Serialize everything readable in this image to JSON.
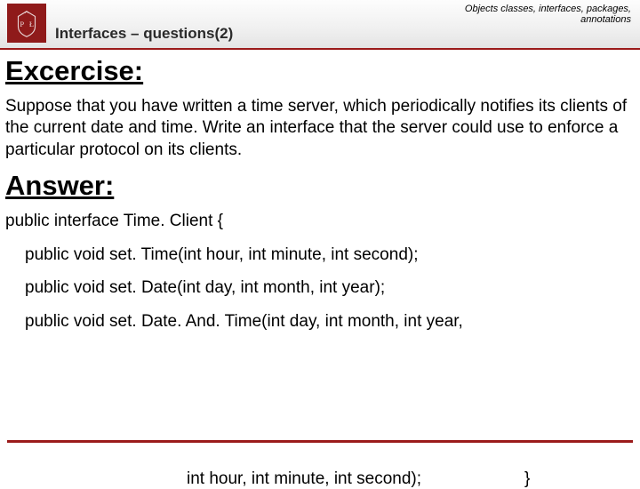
{
  "header": {
    "chapter_line1": "Objects classes, interfaces, packages,",
    "chapter_line2": "annotations",
    "subtitle": "Interfaces – questions(2)"
  },
  "content": {
    "exercise_heading": "Excercise:",
    "exercise_text": "Suppose that you have written a time server, which periodically notifies its clients of the current date and time. Write an interface that the server could use to enforce a particular protocol on its clients.",
    "answer_heading": "Answer:",
    "code": {
      "line1": "public interface Time. Client {",
      "line2": "public void set. Time(int hour, int minute, int second);",
      "line3": "public void set. Date(int day, int month, int year);",
      "line4": "public void set. Date. And. Time(int day, int month, int year,",
      "line5": "int hour, int minute, int second);",
      "close": "}"
    }
  }
}
